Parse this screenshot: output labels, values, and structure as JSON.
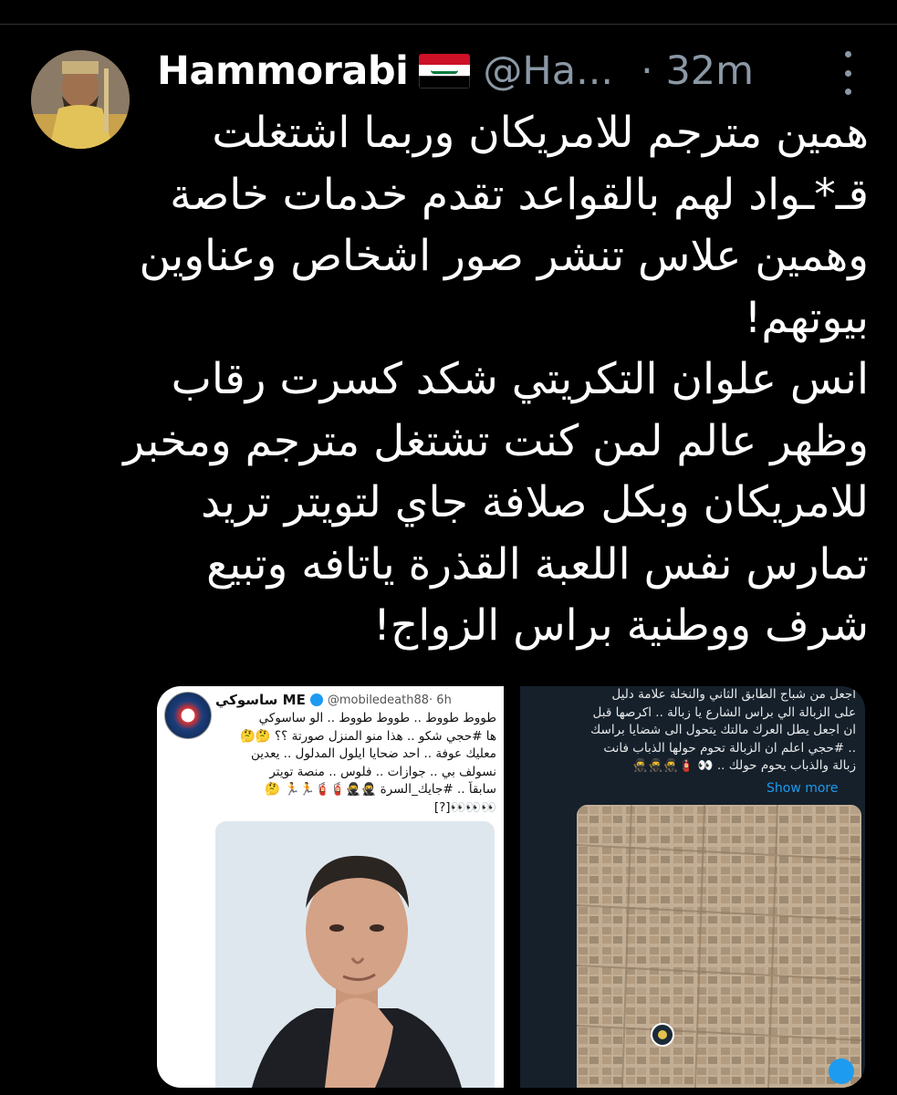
{
  "tweet": {
    "display_name": "Hammorabi",
    "flag": "Iraq",
    "handle": "@Ha...",
    "separator": "·",
    "time": "32m",
    "text_lines": [
      "همين مترجم للامريكان وربما اشتغلت",
      "قـ*ـواد لهم بالقواعد تقدم خدمات خاصة",
      "وهمين علاس تنشر صور اشخاص وعناوين",
      "بيوتهم!",
      "انس علوان التكريتي شكد كسرت رقاب",
      "وظهر عالم لمن كنت تشتغل مترجم ومخبر",
      "للامريكان وبكل صلافة جاي لتويتر تريد",
      "تمارس نفس اللعبة القذرة ياتافه وتبيع",
      "شرف ووطنية براس الزواج!"
    ]
  },
  "embedded_left": {
    "name": "ساسوكي ME",
    "handle": "@mobiledeath88",
    "time": "· 6h",
    "lines": [
      "طووط طووط .. طووط طووط .. الو ساسوكي",
      "ها #حجي شكو .. هذا منو المنزل صورتة ؟؟ 🤔🤔",
      "معليك عوفة .. احد ضحايا ايلول المدلول .. يعدين",
      "نسولف بي .. جوازات .. فلوس .. منصة تويتر",
      "سابقاً .. #جايك_السرة 🥷🥷🧯🧯🏃🏃 🤔",
      "👀👀👀[?]"
    ]
  },
  "embedded_right": {
    "lines": [
      "اجعل من شباج الطابق الثاني والنخلة علامة دليل",
      "على الزبالة الي براس الشارع يا زبالة .. اكرصها قبل",
      "ان اجعل يطل العرك مالتك يتحول الى شضايا براسك",
      ".. #حجي اعلم ان الزبالة تحوم حولها الذباب فانت",
      "زبالة والذباب يحوم حولك .. 👀 🧯🥷🥷🥷"
    ],
    "show_more": "Show more"
  },
  "colors": {
    "background": "#000000",
    "text": "#ffffff",
    "muted": "#8b98a5",
    "link": "#1d9bf0"
  }
}
